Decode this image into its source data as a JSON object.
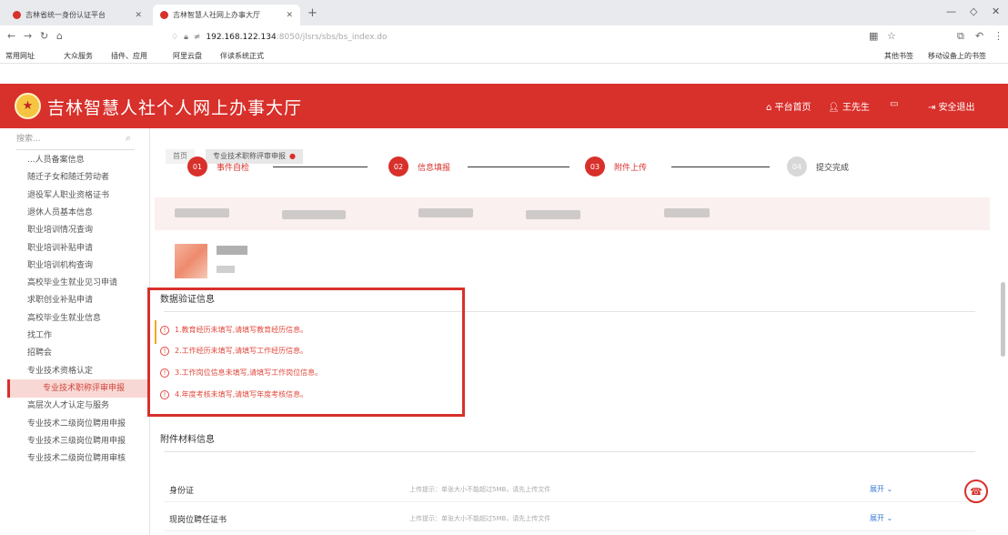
{
  "browser": {
    "tabs": [
      {
        "title": "吉林省统一身份认证平台"
      },
      {
        "title": "吉林智慧人社网上办事大厅"
      }
    ],
    "close_icon": "✕",
    "new_tab": "+",
    "url_host": "192.168.122.134",
    "url_path": ":8050/jlsrs/sbs/bs_index.do",
    "bookmarks_left": [
      "常用网址",
      "大众服务",
      "插件、应用",
      "阿里云盘",
      "伴读系统正式"
    ],
    "bookmarks_right": [
      "其他书签",
      "移动设备上的书签"
    ]
  },
  "header": {
    "title": "吉林智慧人社个人网上办事大厅",
    "nav": [
      "平台首页",
      "王先生",
      "安全退出"
    ]
  },
  "sidebar": {
    "search_placeholder": "搜索...",
    "items": [
      "...人员备案信息",
      "随迁子女和随迁劳动者",
      "退役军人职业资格证书",
      "退休人员基本信息",
      "职业培训情况查询",
      "职业培训补贴申请",
      "职业培训机构查询",
      "高校毕业生就业见习申请",
      "求职创业补贴申请",
      "高校毕业生就业信息",
      "找工作",
      "招聘会",
      "专业技术资格认定",
      "专业技术职称评审申报",
      "高层次人才认定与服务",
      "专业技术二级岗位聘用申报",
      "专业技术三级岗位聘用申报",
      "专业技术二级岗位聘用审核"
    ],
    "active_index": 13
  },
  "main": {
    "tabs": [
      "首页",
      "专业技术职称评审申报"
    ],
    "steps": [
      {
        "num": "01",
        "label": "事件自检"
      },
      {
        "num": "02",
        "label": "信息填报"
      },
      {
        "num": "03",
        "label": "附件上传"
      },
      {
        "num": "04",
        "label": "提交完成"
      }
    ],
    "validation": {
      "title": "数据验证信息",
      "errors": [
        "1.教育经历未填写,请填写教育经历信息。",
        "2.工作经历未填写,请填写工作经历信息。",
        "3.工作岗位信息未填写,请填写工作岗位信息。",
        "4.年度考核未填写,请填写年度考核信息。"
      ]
    },
    "attachments": {
      "title": "附件材料信息",
      "rows": [
        {
          "name": "身份证",
          "hint": "上传提示：单张大小不能超过5MB，请先上传文件",
          "action": "展开"
        },
        {
          "name": "现岗位聘任证书",
          "hint": "上传提示：单张大小不能超过5MB，请先上传文件",
          "action": "展开"
        }
      ]
    }
  },
  "colors": {
    "brand_red": "#d8302b",
    "error": "#e24a3e",
    "link": "#3a7bd5"
  }
}
